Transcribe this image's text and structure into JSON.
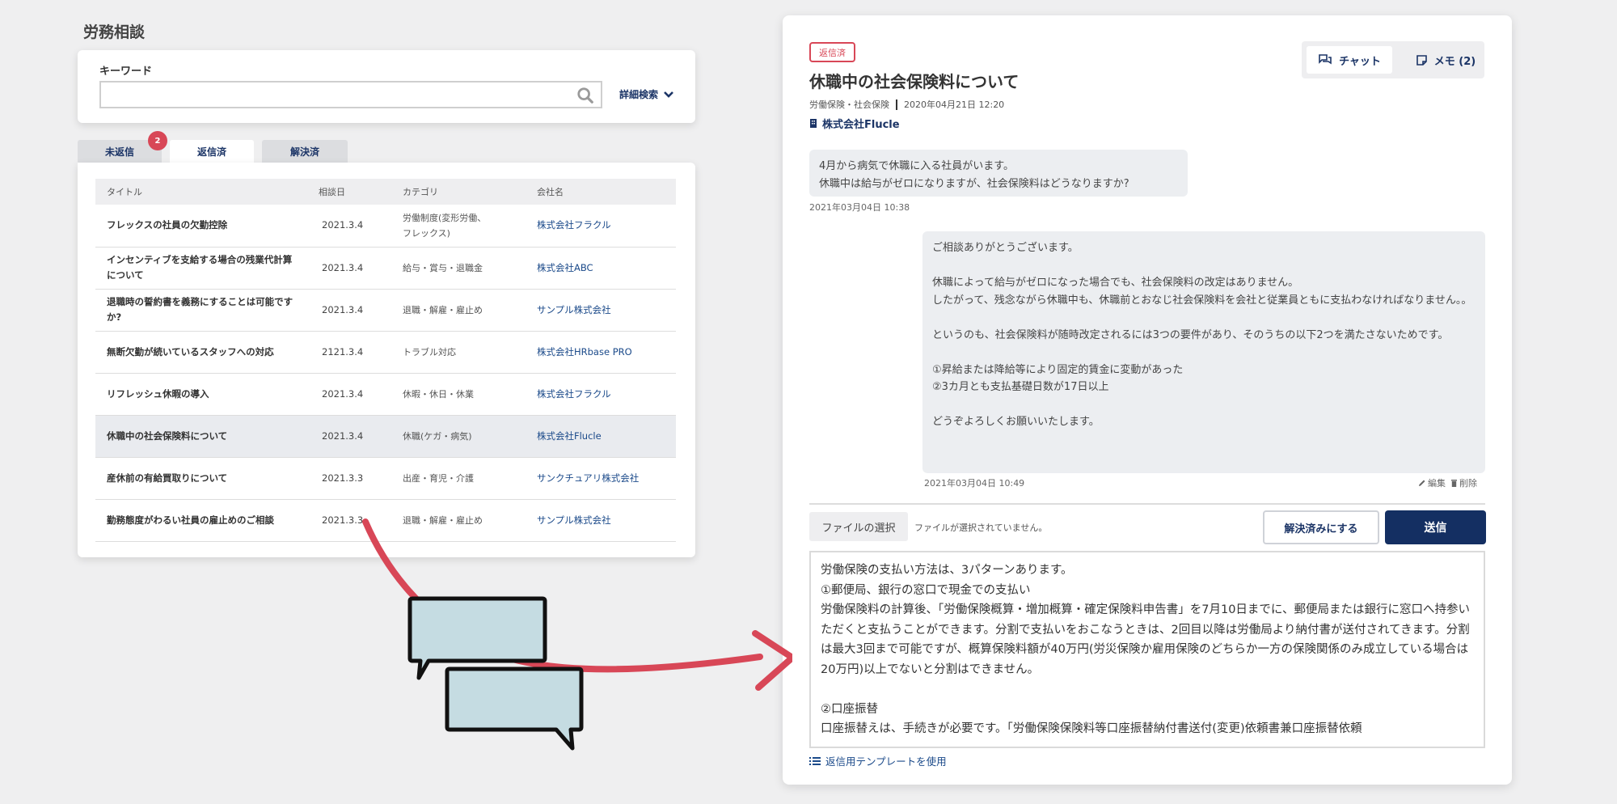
{
  "page_title": "労務相談",
  "search": {
    "label": "キーワード",
    "placeholder": "",
    "advanced_label": "詳細検索"
  },
  "tabs": [
    {
      "label": "未返信",
      "badge": "2"
    },
    {
      "label": "返信済"
    },
    {
      "label": "解決済"
    }
  ],
  "table": {
    "headers": [
      "タイトル",
      "相談日",
      "カテゴリ",
      "会社名"
    ],
    "rows": [
      {
        "title": "フレックスの社員の欠勤控除",
        "date": "2021.3.4",
        "category": "労働制度(変形労働、\nフレックス)",
        "company": "株式会社フラクル"
      },
      {
        "title": "インセンティブを支給する場合の残業代計算について",
        "date": "2021.3.4",
        "category": "給与・賞与・退職金",
        "company": "株式会社ABC"
      },
      {
        "title": "退職時の誓約書を義務にすることは可能ですか?",
        "date": "2021.3.4",
        "category": "退職・解雇・雇止め",
        "company": "サンプル株式会社"
      },
      {
        "title": "無断欠勤が続いているスタッフへの対応",
        "date": "2121.3.4",
        "category": "トラブル対応",
        "company": "株式会社HRbase PRO"
      },
      {
        "title": "リフレッシュ休暇の導入",
        "date": "2021.3.4",
        "category": "休暇・休日・休業",
        "company": "株式会社フラクル"
      },
      {
        "title": "休職中の社会保険料について",
        "date": "2021.3.4",
        "category": "休職(ケガ・病気)",
        "company": "株式会社Flucle"
      },
      {
        "title": "産休前の有給買取りについて",
        "date": "2021.3.3",
        "category": "出産・育児・介護",
        "company": "サンクチュアリ株式会社"
      },
      {
        "title": "勤務態度がわるい社員の雇止めのご相談",
        "date": "2021.3.3",
        "category": "退職・解雇・雇止め",
        "company": "サンプル株式会社"
      }
    ]
  },
  "detail": {
    "status": "返信済",
    "title": "休職中の社会保険料について",
    "category": "労働保険・社会保険",
    "datetime": "2020年04月21日 12:20",
    "company": "株式会社Flucle",
    "switch": {
      "chat": "チャット",
      "memo": "メモ (2)"
    },
    "question": "4月から病気で休職に入る社員がいます。\n休職中は給与がゼロになりますが、社会保険料はどうなりますか?",
    "question_time": "2021年03月04日 10:38",
    "answer": "ご相談ありがとうございます。\n\n休職によって給与がゼロになった場合でも、社会保険料の改定はありません。\nしたがって、残念ながら休職中も、休職前とおなじ社会保険料を会社と従業員ともに支払わなければなりません。。\n\nというのも、社会保険料が随時改定されるには3つの要件があり、そのうちの以下2つを満たさないためです。\n\n①昇給または降給等により固定的賃金に変動があった\n②3カ月とも支払基礎日数が17日以上\n\nどうぞよろしくお願いいたします。",
    "answer_time": "2021年03月04日 10:49",
    "edit_label": "編集",
    "delete_label": "削除",
    "file_button": "ファイルの選択",
    "file_status": "ファイルが選択されていません。",
    "resolve_button": "解決済みにする",
    "send_button": "送信",
    "reply_text": "労働保険の支払い方法は、3パターンあります。\n①郵便局、銀行の窓口で現金での支払い\n労働保険料の計算後、「労働保険概算・増加概算・確定保険料申告書」を7月10日までに、郵便局または銀行に窓口へ持参いただくと支払うことができます。分割で支払いをおこなうときは、2回目以降は労働局より納付書が送付されてきます。分割は最大3回まで可能ですが、概算保険料額が40万円(労災保険か雇用保険のどちらか一方の保険関係のみ成立している場合は20万円)以上でないと分割はできません。\n\n②口座振替\n口座振替えは、手続きが必要です。「労働保険保険料等口座振替納付書送付(変更)依頼書兼口座振替依頼",
    "template_link": "返信用テンプレートを使用"
  },
  "colors": {
    "navy": "#142f62",
    "accent_red": "#d84757",
    "bubble_fill": "#c5dce2"
  }
}
